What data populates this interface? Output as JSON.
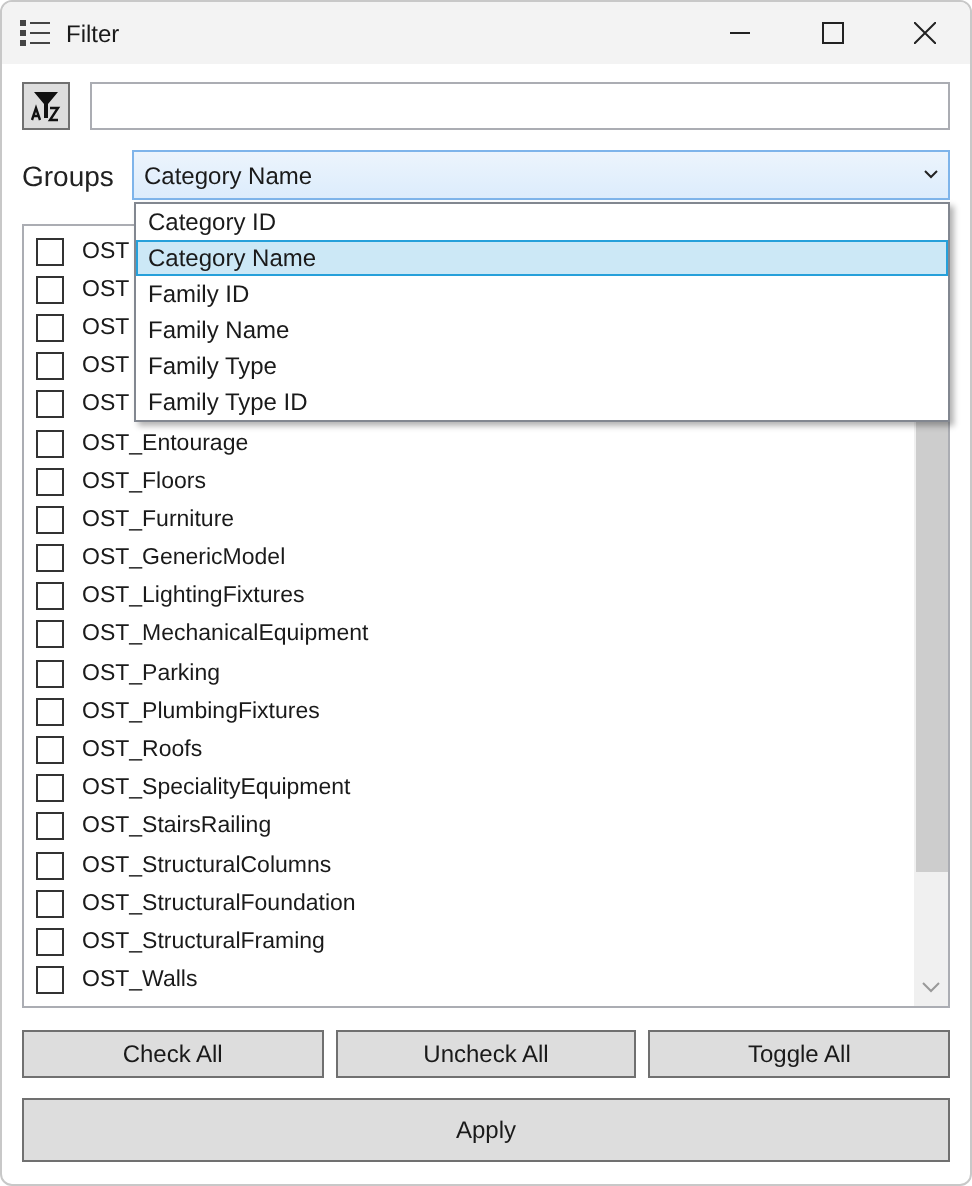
{
  "window": {
    "title": "Filter"
  },
  "groups": {
    "label": "Groups",
    "value": "Category Name",
    "expanded": true,
    "options": [
      {
        "label": "Category ID",
        "selected": false
      },
      {
        "label": "Category Name",
        "selected": true
      },
      {
        "label": "Family ID",
        "selected": false
      },
      {
        "label": "Family Name",
        "selected": false
      },
      {
        "label": "Family Type",
        "selected": false
      },
      {
        "label": "Family Type ID",
        "selected": false
      }
    ]
  },
  "items": [
    {
      "label": "OST",
      "checked": false
    },
    {
      "label": "OST",
      "checked": false
    },
    {
      "label": "OST",
      "checked": false
    },
    {
      "label": "OST",
      "checked": false
    },
    {
      "label": "OST",
      "checked": false
    },
    {
      "label": "OST_Entourage",
      "checked": false
    },
    {
      "label": "OST_Floors",
      "checked": false
    },
    {
      "label": "OST_Furniture",
      "checked": false
    },
    {
      "label": "OST_GenericModel",
      "checked": false
    },
    {
      "label": "OST_LightingFixtures",
      "checked": false
    },
    {
      "label": "OST_MechanicalEquipment",
      "checked": false
    },
    {
      "label": "OST_Parking",
      "checked": false
    },
    {
      "label": "OST_PlumbingFixtures",
      "checked": false
    },
    {
      "label": "OST_Roofs",
      "checked": false
    },
    {
      "label": "OST_SpecialityEquipment",
      "checked": false
    },
    {
      "label": "OST_StairsRailing",
      "checked": false
    },
    {
      "label": "OST_StructuralColumns",
      "checked": false
    },
    {
      "label": "OST_StructuralFoundation",
      "checked": false
    },
    {
      "label": "OST_StructuralFraming",
      "checked": false
    },
    {
      "label": "OST_Walls",
      "checked": false
    }
  ],
  "buttons": [
    "Check All",
    "Uncheck All",
    "Toggle All"
  ],
  "apply": "Apply"
}
